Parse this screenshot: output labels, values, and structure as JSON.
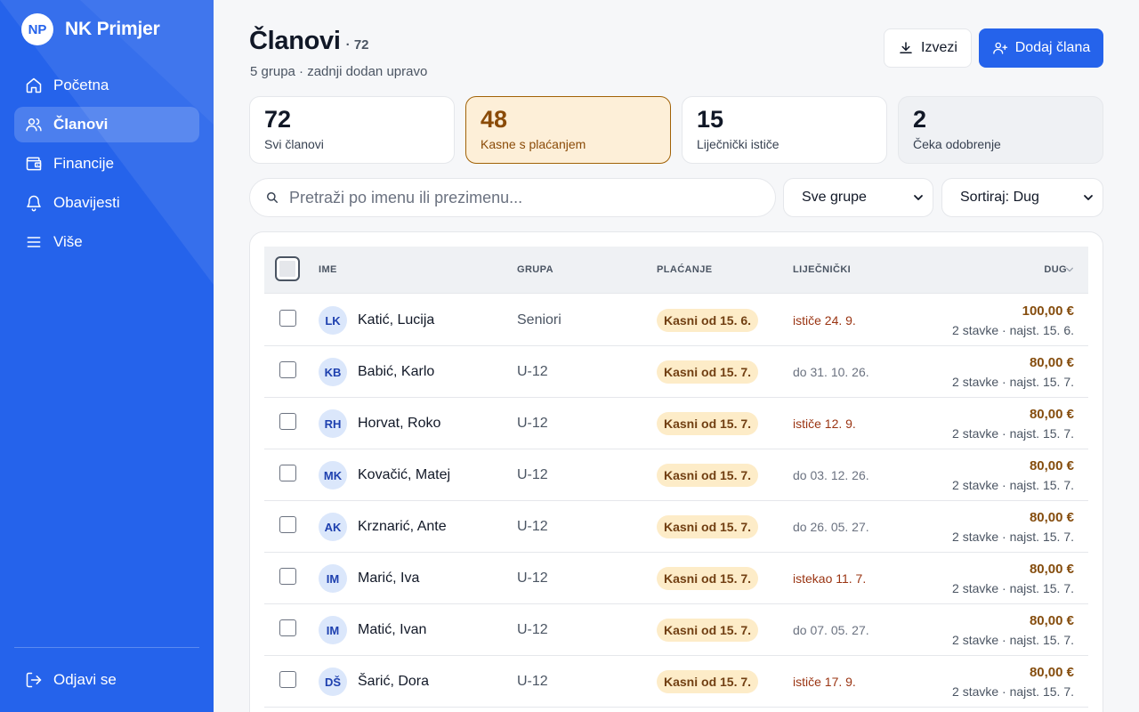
{
  "sidebar": {
    "logo": "NP",
    "brand": "NK Primjer",
    "items": [
      {
        "label": "Početna",
        "icon": "home-icon"
      },
      {
        "label": "Članovi",
        "icon": "users-icon",
        "active": true
      },
      {
        "label": "Financije",
        "icon": "wallet-icon"
      },
      {
        "label": "Obavijesti",
        "icon": "bell-icon"
      },
      {
        "label": "Više",
        "icon": "menu-icon"
      }
    ],
    "logout": "Odjavi se"
  },
  "header": {
    "title": "Članovi",
    "count": "· 72",
    "subtitle": "5 grupa · zadnji dodan upravo",
    "export_label": "Izvezi",
    "add_label": "Dodaj člana"
  },
  "stats": [
    {
      "value": "72",
      "label": "Svi članovi"
    },
    {
      "value": "48",
      "label": "Kasne s plaćanjem"
    },
    {
      "value": "15",
      "label": "Liječnički ističe"
    },
    {
      "value": "2",
      "label": "Čeka odobrenje"
    }
  ],
  "filters": {
    "search_placeholder": "Pretraži po imenu ili prezimenu...",
    "group_value": "Sve grupe",
    "sort_value": "Sortiraj: Dug"
  },
  "table": {
    "columns": {
      "ime": "IME",
      "grupa": "GRUPA",
      "placanje": "PLAĆANJE",
      "lijecnicki": "LIJEČNIČKI",
      "dug": "DUG"
    },
    "rows": [
      {
        "initials": "LK",
        "name": "Katić, Lucija",
        "group": "Seniori",
        "payment": "Kasni od 15. 6.",
        "medical": "ističe 24. 9.",
        "medical_warn": true,
        "amount": "100,00 €",
        "amount_sub": "2 stavke · najst. 15. 6."
      },
      {
        "initials": "KB",
        "name": "Babić, Karlo",
        "group": "U-12",
        "payment": "Kasni od 15. 7.",
        "medical": "do 31. 10. 26.",
        "medical_warn": false,
        "amount": "80,00 €",
        "amount_sub": "2 stavke · najst. 15. 7."
      },
      {
        "initials": "RH",
        "name": "Horvat, Roko",
        "group": "U-12",
        "payment": "Kasni od 15. 7.",
        "medical": "ističe 12. 9.",
        "medical_warn": true,
        "amount": "80,00 €",
        "amount_sub": "2 stavke · najst. 15. 7."
      },
      {
        "initials": "MK",
        "name": "Kovačić, Matej",
        "group": "U-12",
        "payment": "Kasni od 15. 7.",
        "medical": "do 03. 12. 26.",
        "medical_warn": false,
        "amount": "80,00 €",
        "amount_sub": "2 stavke · najst. 15. 7."
      },
      {
        "initials": "AK",
        "name": "Krznarić, Ante",
        "group": "U-12",
        "payment": "Kasni od 15. 7.",
        "medical": "do 26. 05. 27.",
        "medical_warn": false,
        "amount": "80,00 €",
        "amount_sub": "2 stavke · najst. 15. 7."
      },
      {
        "initials": "IM",
        "name": "Marić, Iva",
        "group": "U-12",
        "payment": "Kasni od 15. 7.",
        "medical": "istekao 11. 7.",
        "medical_warn": true,
        "amount": "80,00 €",
        "amount_sub": "2 stavke · najst. 15. 7."
      },
      {
        "initials": "IM",
        "name": "Matić, Ivan",
        "group": "U-12",
        "payment": "Kasni od 15. 7.",
        "medical": "do 07. 05. 27.",
        "medical_warn": false,
        "amount": "80,00 €",
        "amount_sub": "2 stavke · najst. 15. 7."
      },
      {
        "initials": "DŠ",
        "name": "Šarić, Dora",
        "group": "U-12",
        "payment": "Kasni od 15. 7.",
        "medical": "ističe 17. 9.",
        "medical_warn": true,
        "amount": "80,00 €",
        "amount_sub": "2 stavke · najst. 15. 7."
      }
    ]
  },
  "colors": {
    "accent": "#2563eb",
    "warning_bg": "#fdefd8",
    "warning_text": "#8a4b08",
    "badge_bg": "#fdecc8"
  }
}
